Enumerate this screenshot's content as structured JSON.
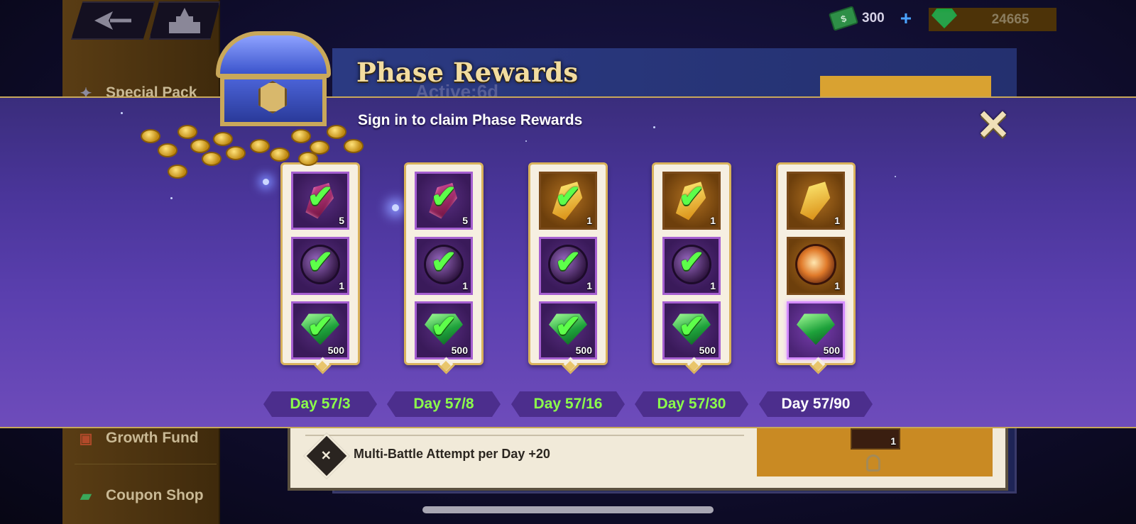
{
  "currency": {
    "cash_value": "300",
    "cash_icon": "dollar-bill-icon",
    "cash_icon_label": "$",
    "plus_label": "+",
    "gems_value": "24665",
    "gems_icon": "green-gem-icon"
  },
  "sidebar": {
    "items": [
      {
        "label": "Special Pack",
        "icon": "special-pack-icon"
      },
      {
        "label": "Growth Fund",
        "icon": "growth-fund-chest-icon"
      },
      {
        "label": "Coupon Shop",
        "icon": "coupon-icon"
      }
    ]
  },
  "background": {
    "page_title": "Phase Rewards",
    "active_text": "Active:6d",
    "privilege_row_text": "Multi-Battle Attempt per Day +20",
    "privilege_slot_qty": "1"
  },
  "modal": {
    "subtitle": "Sign in to claim Phase Rewards",
    "close_label": "✕",
    "days": [
      {
        "label": "Day 57/3",
        "current": false,
        "rewards": [
          {
            "item": "red-shard",
            "qty": "5",
            "claimed": true
          },
          {
            "item": "purple-orb",
            "qty": "1",
            "claimed": true
          },
          {
            "item": "green-gem",
            "qty": "500",
            "claimed": true
          }
        ]
      },
      {
        "label": "Day 57/8",
        "current": false,
        "rewards": [
          {
            "item": "red-shard",
            "qty": "5",
            "claimed": true
          },
          {
            "item": "purple-orb",
            "qty": "1",
            "claimed": true
          },
          {
            "item": "green-gem",
            "qty": "500",
            "claimed": true
          }
        ]
      },
      {
        "label": "Day 57/16",
        "current": false,
        "rewards": [
          {
            "item": "gold-shard",
            "qty": "1",
            "claimed": true
          },
          {
            "item": "purple-orb",
            "qty": "1",
            "claimed": true
          },
          {
            "item": "green-gem",
            "qty": "500",
            "claimed": true
          }
        ]
      },
      {
        "label": "Day 57/30",
        "current": false,
        "rewards": [
          {
            "item": "gold-shard",
            "qty": "1",
            "claimed": true
          },
          {
            "item": "purple-orb",
            "qty": "1",
            "claimed": true
          },
          {
            "item": "green-gem",
            "qty": "500",
            "claimed": true
          }
        ]
      },
      {
        "label": "Day 57/90",
        "current": true,
        "rewards": [
          {
            "item": "gold-shard",
            "qty": "1",
            "claimed": false
          },
          {
            "item": "fire-orb",
            "qty": "1",
            "claimed": false
          },
          {
            "item": "green-gem",
            "qty": "500",
            "claimed": false
          }
        ]
      }
    ]
  },
  "colors": {
    "claimed_check": "#5dff4a",
    "day_tab_text": "#8bff4a",
    "modal_gradient_top": "#3a2d7c",
    "modal_gradient_bottom": "#6e4cbb",
    "gold_border": "#d9b25c"
  }
}
